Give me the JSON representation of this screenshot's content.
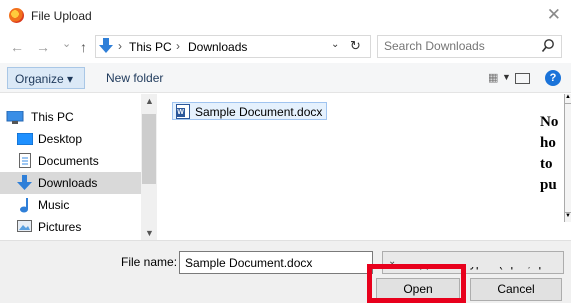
{
  "window": {
    "title": "File Upload",
    "close_glyph": "✕"
  },
  "nav": {
    "back_glyph": "←",
    "forward_glyph": "→",
    "recent_glyph": "⌄",
    "up_glyph": "↑"
  },
  "address": {
    "crumbs": [
      "This PC",
      "Downloads"
    ],
    "separator": "›",
    "dropdown_glyph": "⌄",
    "refresh_glyph": "↻"
  },
  "search": {
    "placeholder": "Search Downloads"
  },
  "toolbar": {
    "organize_label": "Organize ▾",
    "new_folder_label": "New folder",
    "view_glyph": "▦",
    "view_dropdown_glyph": "▼",
    "help_glyph": "?"
  },
  "sidebar": {
    "items": [
      {
        "label": "This PC",
        "icon": "computer-icon",
        "selected": false
      },
      {
        "label": "Desktop",
        "icon": "desktop-icon",
        "selected": false
      },
      {
        "label": "Documents",
        "icon": "documents-icon",
        "selected": false
      },
      {
        "label": "Downloads",
        "icon": "downloads-icon",
        "selected": true
      },
      {
        "label": "Music",
        "icon": "music-icon",
        "selected": false
      },
      {
        "label": "Pictures",
        "icon": "pictures-icon",
        "selected": false
      }
    ],
    "scroll_up_glyph": "▲",
    "scroll_down_glyph": "▼"
  },
  "files": [
    {
      "name": "Sample Document.docx",
      "icon": "word-document-icon"
    }
  ],
  "preview": {
    "lines": [
      "No",
      "ho",
      "to",
      "pu"
    ]
  },
  "footer": {
    "file_name_label": "File name:",
    "file_name_value": "Sample Document.docx",
    "filter_value": "All Supported Types (*.pdf;*.ppt",
    "dropdown_glyph": "⌄",
    "open_label": "Open",
    "cancel_label": "Cancel"
  },
  "colors": {
    "highlight": "#e8001c",
    "selection": "#d9d9d9",
    "accent": "#1a73d9"
  }
}
